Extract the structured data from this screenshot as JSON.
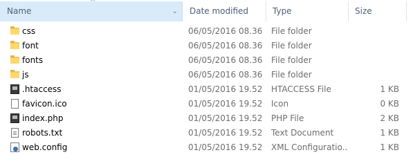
{
  "columns": {
    "name": "Name",
    "date": "Date modified",
    "type": "Type",
    "size": "Size"
  },
  "files": [
    {
      "name": "css",
      "date": "06/05/2016 08.36",
      "type": "File folder",
      "size": "",
      "icon": "folder-icon"
    },
    {
      "name": "font",
      "date": "06/05/2016 08.36",
      "type": "File folder",
      "size": "",
      "icon": "folder-icon"
    },
    {
      "name": "fonts",
      "date": "06/05/2016 08.36",
      "type": "File folder",
      "size": "",
      "icon": "folder-icon"
    },
    {
      "name": "js",
      "date": "06/05/2016 08.36",
      "type": "File folder",
      "size": "",
      "icon": "folder-icon"
    },
    {
      "name": ".htaccess",
      "date": "01/05/2016 19.52",
      "type": "HTACCESS File",
      "size": "1 KB",
      "icon": "app-file-icon"
    },
    {
      "name": "favicon.ico",
      "date": "01/05/2016 19.52",
      "type": "Icon",
      "size": "0 KB",
      "icon": "blank-file-icon"
    },
    {
      "name": "index.php",
      "date": "01/05/2016 19.52",
      "type": "PHP File",
      "size": "2 KB",
      "icon": "app-file-icon"
    },
    {
      "name": "robots.txt",
      "date": "01/05/2016 19.52",
      "type": "Text Document",
      "size": "1 KB",
      "icon": "text-file-icon"
    },
    {
      "name": "web.config",
      "date": "01/05/2016 19.52",
      "type": "XML Configuratio...",
      "size": "1 KB",
      "icon": "config-file-icon"
    }
  ]
}
